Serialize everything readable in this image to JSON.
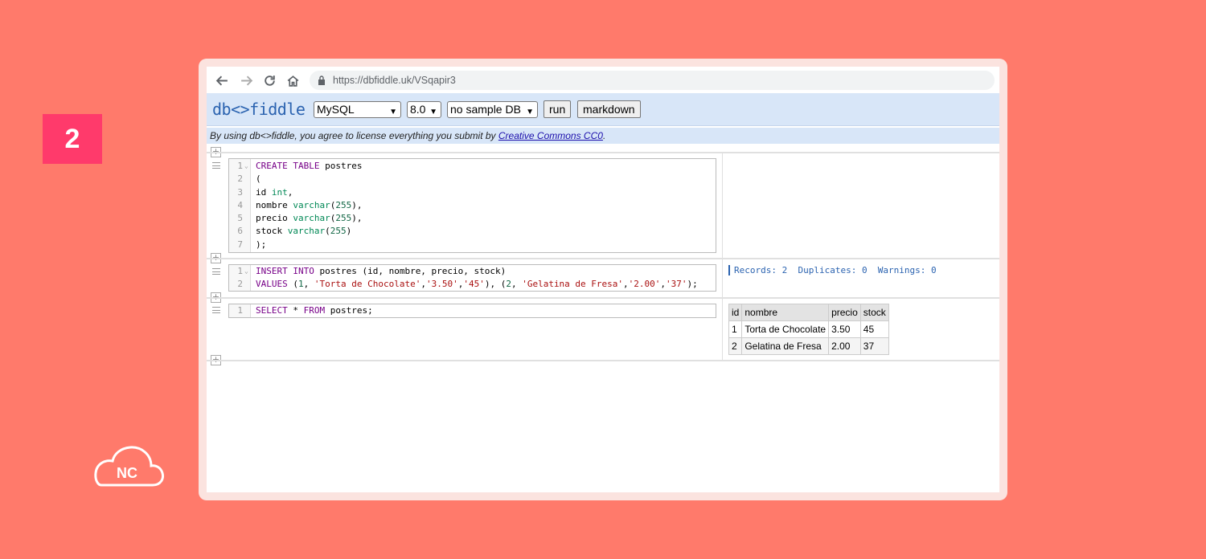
{
  "badge": {
    "number": "2"
  },
  "logo_text": "NC",
  "browser": {
    "url": "https://dbfiddle.uk/VSqapir3"
  },
  "app": {
    "logo": "db<>fiddle",
    "db_engine": "MySQL",
    "db_version": "8.0",
    "sample_db": "no sample DB",
    "run_label": "run",
    "markdown_label": "markdown",
    "license_text": "By using db<>fiddle, you agree to license everything you submit by ",
    "license_link": "Creative Commons CC0",
    "license_end": "."
  },
  "blocks": [
    {
      "lines": [
        {
          "n": "1",
          "fold": true
        },
        {
          "n": "2"
        },
        {
          "n": "3"
        },
        {
          "n": "4"
        },
        {
          "n": "5"
        },
        {
          "n": "6"
        },
        {
          "n": "7"
        }
      ]
    },
    {
      "lines": [
        {
          "n": "1",
          "fold": true
        },
        {
          "n": "2"
        }
      ]
    },
    {
      "lines": [
        {
          "n": "1"
        }
      ]
    }
  ],
  "results": {
    "insert_message": "Records: 2  Duplicates: 0  Warnings: 0",
    "table": {
      "columns": [
        "id",
        "nombre",
        "precio",
        "stock"
      ],
      "rows": [
        [
          "1",
          "Torta de Chocolate",
          "3.50",
          "45"
        ],
        [
          "2",
          "Gelatina de Fresa",
          "2.00",
          "37"
        ]
      ]
    }
  },
  "colors": {
    "background": "#ff7a6b",
    "badge": "#ff3a6b",
    "toolbar": "#d8e6f8",
    "accent": "#2b63b0"
  },
  "icons": [
    "back-arrow-icon",
    "forward-arrow-icon",
    "reload-icon",
    "home-icon",
    "lock-icon",
    "cloud-logo-icon"
  ]
}
